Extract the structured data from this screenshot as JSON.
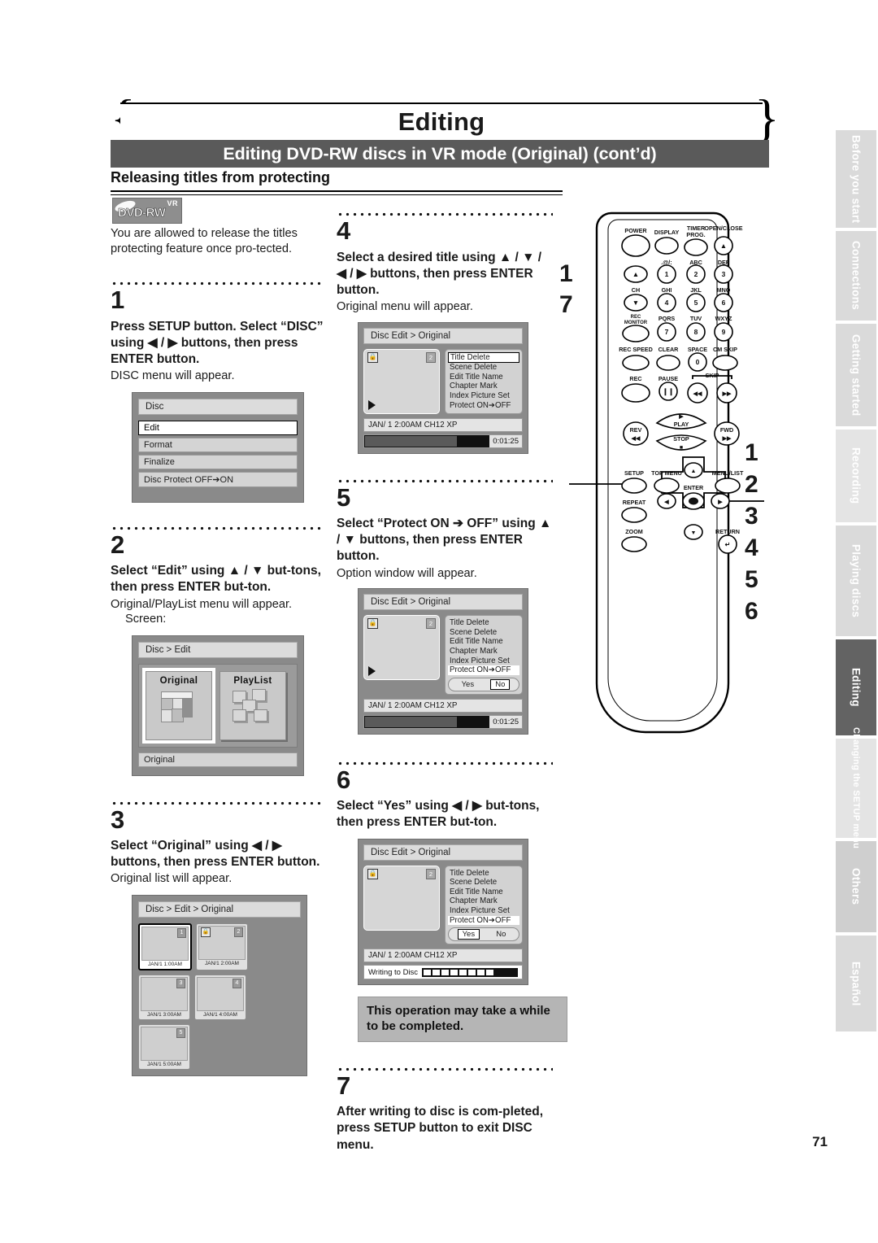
{
  "header": {
    "chapter": "Editing",
    "section": "Editing DVD-RW discs in VR mode (Original) (cont’d)",
    "subsection": "Releasing titles from protecting"
  },
  "logo": {
    "format": "DVD-RW",
    "mode": "VR"
  },
  "intro": "You are allowed to release the titles protecting feature once pro-tected.",
  "steps": [
    {
      "number": "1",
      "bold": "Press SETUP button. Select “DISC” using ◀ / ▶ buttons, then press ENTER button.",
      "note": "DISC menu will appear."
    },
    {
      "number": "2",
      "bold": "Select “Edit” using ▲ / ▼ but-tons, then press ENTER but-ton.",
      "note": "Original/PlayList menu will appear.",
      "note2": "Screen:"
    },
    {
      "number": "3",
      "bold": "Select “Original” using ◀ / ▶ buttons, then press ENTER button.",
      "note": "Original list will appear."
    },
    {
      "number": "4",
      "bold": "Select a desired title using ▲ / ▼ / ◀ / ▶ buttons, then press ENTER button.",
      "note": "Original menu will appear."
    },
    {
      "number": "5",
      "bold": "Select “Protect ON ➔ OFF” using ▲ / ▼ buttons, then press ENTER button.",
      "note": "Option window will appear."
    },
    {
      "number": "6",
      "bold": "Select “Yes” using ◀ / ▶ but-tons, then press ENTER but-ton.",
      "note": ""
    },
    {
      "number": "7",
      "bold": "After writing to disc is com-pleted, press SETUP button to exit DISC menu.",
      "note": ""
    }
  ],
  "callout_note": "This operation may take a while to be completed.",
  "osd_disc_menu": {
    "title": "Disc",
    "items": [
      "Edit",
      "Format",
      "Finalize",
      "Disc Protect OFF➔ON"
    ],
    "selected": "Edit"
  },
  "osd_edit_menu": {
    "title": "Disc > Edit",
    "cards": [
      "Original",
      "PlayList"
    ],
    "selected": "Original",
    "status": "Original"
  },
  "osd_original_list": {
    "title": "Disc > Edit > Original",
    "thumbs": [
      {
        "no": "1",
        "caption": "JAN/1  1:00AM",
        "locked": false,
        "selected": true
      },
      {
        "no": "2",
        "caption": "JAN/1  2:00AM",
        "locked": true,
        "selected": false
      },
      {
        "no": "3",
        "caption": "JAN/1  3:00AM",
        "locked": false,
        "selected": false
      },
      {
        "no": "4",
        "caption": "JAN/1  4:00AM",
        "locked": false,
        "selected": false
      },
      {
        "no": "5",
        "caption": "JAN/1  5:00AM",
        "locked": false,
        "selected": false
      }
    ]
  },
  "osd_title_edit": {
    "title": "Disc Edit > Original",
    "menu": [
      "Title Delete",
      "Scene Delete",
      "Edit Title Name",
      "Chapter Mark",
      "Index Picture Set",
      "Protect ON➔OFF"
    ],
    "thumb_no": "2",
    "info": "JAN/ 1   2:00AM  CH12    XP",
    "time": "0:01:25",
    "writing_label": "Writing to Disc",
    "yes": "Yes",
    "no": "No",
    "step4_selected": "Title Delete",
    "step5_selected": "Protect ON➔OFF",
    "step5_answer": "No",
    "step6_answer": "Yes"
  },
  "remote": {
    "rows": [
      {
        "labels": [
          "POWER",
          "DISPLAY",
          "TIMER PROG.",
          "OPEN/CLOSE"
        ]
      },
      {
        "labels": [
          "",
          ".@/:",
          "ABC",
          "DEF"
        ],
        "keys": [
          "▲",
          "1",
          "2",
          "3"
        ]
      },
      {
        "labels": [
          "CH",
          "GHI",
          "JKL",
          "MNO"
        ],
        "keys": [
          "▼",
          "4",
          "5",
          "6"
        ]
      },
      {
        "labels": [
          "REC MONITOR",
          "PQRS",
          "TUV",
          "WXYZ"
        ],
        "keys": [
          "",
          "7",
          "8",
          "9"
        ]
      },
      {
        "labels": [
          "REC SPEED",
          "CLEAR",
          "SPACE",
          "CM SKIP"
        ],
        "keys": [
          "",
          "",
          "0",
          ""
        ]
      },
      {
        "labels": [
          "REC",
          "PAUSE",
          "SKIP",
          ""
        ],
        "keys": [
          "",
          "❙❙",
          "◀◀",
          "▶▶"
        ]
      }
    ],
    "transport": {
      "play": "PLAY",
      "stop": "STOP",
      "rev": "REV",
      "fwd": "FWD"
    },
    "menu_keys": [
      "SETUP",
      "TOP MENU",
      "MENU/LIST",
      "REPEAT",
      "ENTER",
      "ZOOM",
      "RETURN"
    ]
  },
  "callouts": {
    "left": [
      "1",
      "7"
    ],
    "right": [
      "1",
      "2",
      "3",
      "4",
      "5",
      "6"
    ]
  },
  "side_tabs": [
    {
      "label": "Before you start",
      "state": "light"
    },
    {
      "label": "Connections",
      "state": "light"
    },
    {
      "label": "Getting started",
      "state": "light"
    },
    {
      "label": "Recording",
      "state": "lighter"
    },
    {
      "label": "Playing discs",
      "state": "light"
    },
    {
      "label": "Editing",
      "state": "active"
    },
    {
      "label": "Changing the SETUP menu",
      "state": "lighter"
    },
    {
      "label": "Others",
      "state": "light2"
    },
    {
      "label": "Español",
      "state": "light"
    }
  ],
  "page_number": "71"
}
